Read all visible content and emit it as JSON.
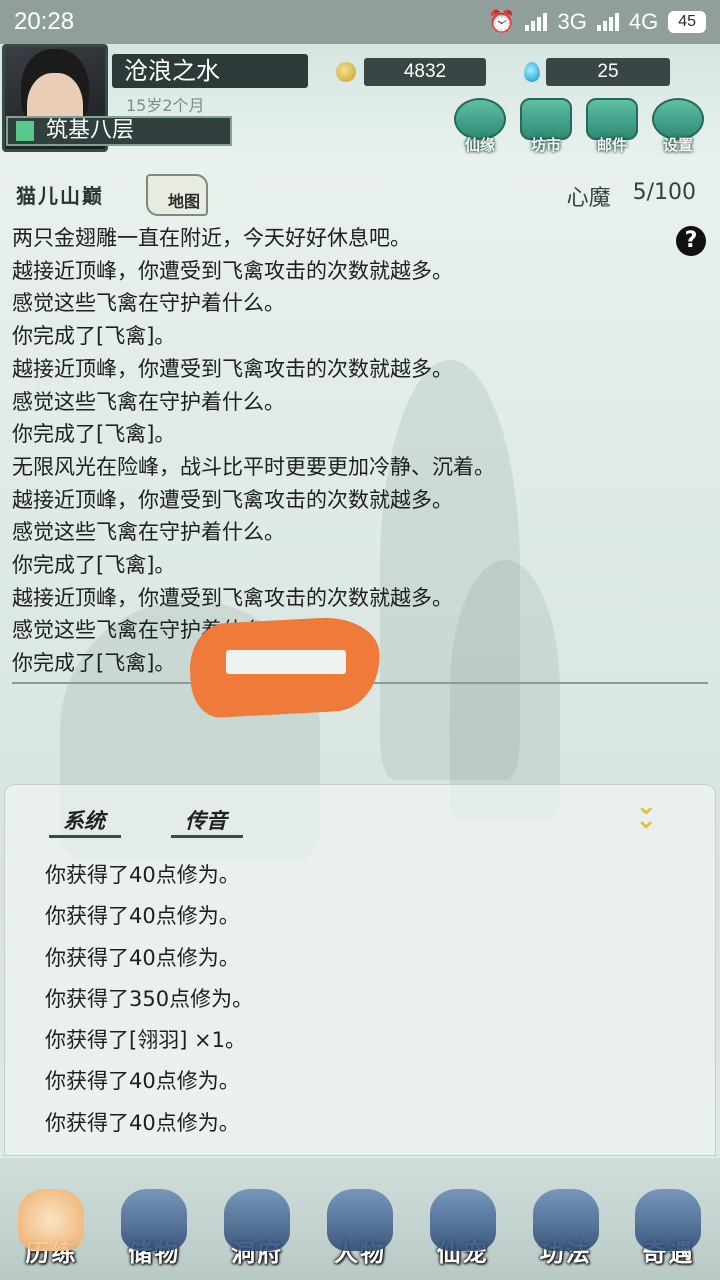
{
  "status_bar": {
    "time": "20:28",
    "network1": "3G",
    "network2": "4G",
    "battery": "45"
  },
  "player": {
    "name": "沧浪之水",
    "age": "15岁2个月",
    "coins": "4832",
    "gems": "25",
    "realm": "筑基八层"
  },
  "top_menu": [
    {
      "label": "仙缘",
      "icon": "cloud-icon"
    },
    {
      "label": "坊市",
      "icon": "market-icon"
    },
    {
      "label": "邮件",
      "icon": "mail-icon"
    },
    {
      "label": "设置",
      "icon": "gear-icon"
    }
  ],
  "location": {
    "name": "猫儿山巅",
    "map_label": "地图",
    "xinmo_label": "心魔",
    "xinmo_value": "5/100"
  },
  "story_log": [
    "两只金翅雕一直在附近，今天好好休息吧。",
    "越接近顶峰，你遭受到飞禽攻击的次数就越多。",
    "感觉这些飞禽在守护着什么。",
    "你完成了[飞禽]。",
    "越接近顶峰，你遭受到飞禽攻击的次数就越多。",
    "感觉这些飞禽在守护着什么。",
    "你完成了[飞禽]。",
    "无限风光在险峰，战斗比平时更要更加冷静、沉着。",
    "越接近顶峰，你遭受到飞禽攻击的次数就越多。",
    "感觉这些飞禽在守护着什么。",
    "你完成了[飞禽]。",
    "越接近顶峰，你遭受到飞禽攻击的次数就越多。",
    "感觉这些飞禽在守护着什么。",
    "你完成了[飞禽]。"
  ],
  "panel": {
    "tabs": [
      "系统",
      "传音"
    ],
    "messages": [
      "你获得了40点修为。",
      "你获得了40点修为。",
      "你获得了40点修为。",
      "你获得了350点修为。",
      "你获得了[翎羽] ×1。",
      "你获得了40点修为。",
      "你获得了40点修为。"
    ]
  },
  "bottom_nav": [
    {
      "label": "历练",
      "active": true
    },
    {
      "label": "储物",
      "active": false
    },
    {
      "label": "洞府",
      "active": false
    },
    {
      "label": "人物",
      "active": false
    },
    {
      "label": "仙宠",
      "active": false
    },
    {
      "label": "功法",
      "active": false
    },
    {
      "label": "奇遇",
      "active": false
    }
  ],
  "colors": {
    "accent": "#58c98a",
    "redaction": "#f07a3a",
    "nav_active": "#f3a85f"
  }
}
